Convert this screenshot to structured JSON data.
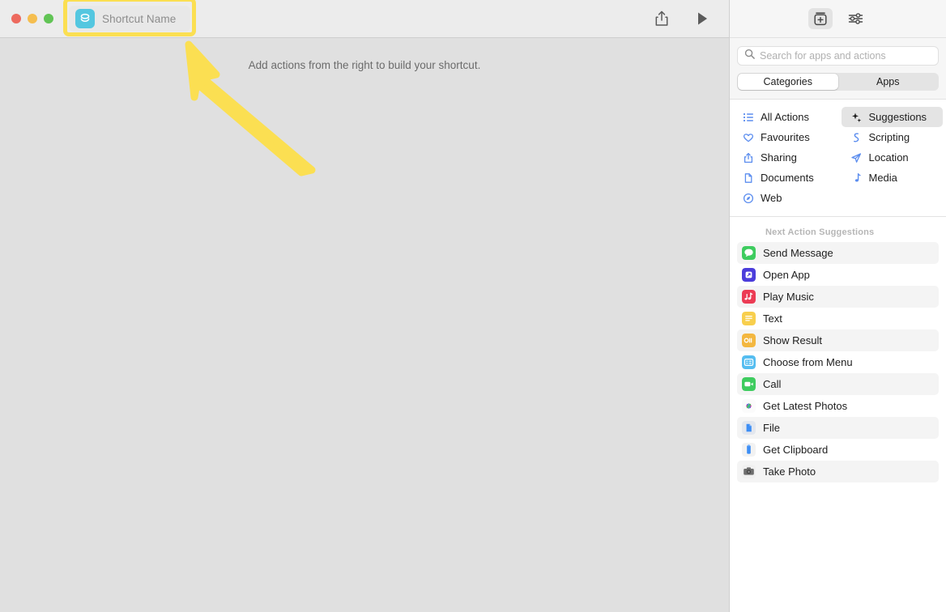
{
  "window": {
    "traffic_lights": [
      {
        "name": "close",
        "color": "#ed6a5e"
      },
      {
        "name": "minimize",
        "color": "#f5be4f"
      },
      {
        "name": "maximize",
        "color": "#61c455"
      }
    ]
  },
  "titlebar": {
    "shortcut_icon": "shortcut-layers-icon",
    "shortcut_name_placeholder": "Shortcut Name",
    "shortcut_name_value": "",
    "share_icon": "share-icon",
    "run_icon": "play-icon"
  },
  "canvas": {
    "hint": "Add actions from the right to build your shortcut."
  },
  "annotation": {
    "highlight_color": "#fbdf52",
    "arrow_color": "#fbdf52",
    "target": "shortcut-name-field"
  },
  "library": {
    "toolbar": {
      "action_library_icon": "add-action-library-icon",
      "action_library_active": true,
      "settings_icon": "sliders-icon"
    },
    "search": {
      "icon": "search-icon",
      "placeholder": "Search for apps and actions",
      "value": ""
    },
    "segmented": {
      "options": [
        "Categories",
        "Apps"
      ],
      "selected": "Categories"
    },
    "categories": [
      {
        "label": "All Actions",
        "icon": "list-bullet-icon",
        "selected": false
      },
      {
        "label": "Suggestions",
        "icon": "sparkles-icon",
        "selected": true
      },
      {
        "label": "Favourites",
        "icon": "heart-icon",
        "selected": false
      },
      {
        "label": "Scripting",
        "icon": "scripting-icon",
        "selected": false
      },
      {
        "label": "Sharing",
        "icon": "share-up-icon",
        "selected": false
      },
      {
        "label": "Location",
        "icon": "paper-plane-icon",
        "selected": false
      },
      {
        "label": "Documents",
        "icon": "document-icon",
        "selected": false
      },
      {
        "label": "Media",
        "icon": "music-note-icon",
        "selected": false
      },
      {
        "label": "Web",
        "icon": "compass-icon",
        "selected": false
      }
    ],
    "suggestions_header": "Next Action Suggestions",
    "suggestions": [
      {
        "label": "Send Message",
        "icon": "messages-icon",
        "icon_color": "#3ecc5f"
      },
      {
        "label": "Open App",
        "icon": "open-app-icon",
        "icon_color": "#4b3ddb"
      },
      {
        "label": "Play Music",
        "icon": "music-icon",
        "icon_color": "#ec3b54"
      },
      {
        "label": "Text",
        "icon": "text-icon",
        "icon_color": "#f8cf4d"
      },
      {
        "label": "Show Result",
        "icon": "show-result-icon",
        "icon_color": "#f3b740"
      },
      {
        "label": "Choose from Menu",
        "icon": "menu-icon",
        "icon_color": "#55bdf0"
      },
      {
        "label": "Call",
        "icon": "call-icon",
        "icon_color": "#3ecc5f"
      },
      {
        "label": "Get Latest Photos",
        "icon": "photos-icon",
        "icon_color": "#f5f5f5"
      },
      {
        "label": "File",
        "icon": "file-icon",
        "icon_color": "#dfe3ea"
      },
      {
        "label": "Get Clipboard",
        "icon": "clipboard-icon",
        "icon_color": "#f0f0f0"
      },
      {
        "label": "Take Photo",
        "icon": "camera-icon",
        "icon_color": "#6e6e6e"
      }
    ]
  }
}
